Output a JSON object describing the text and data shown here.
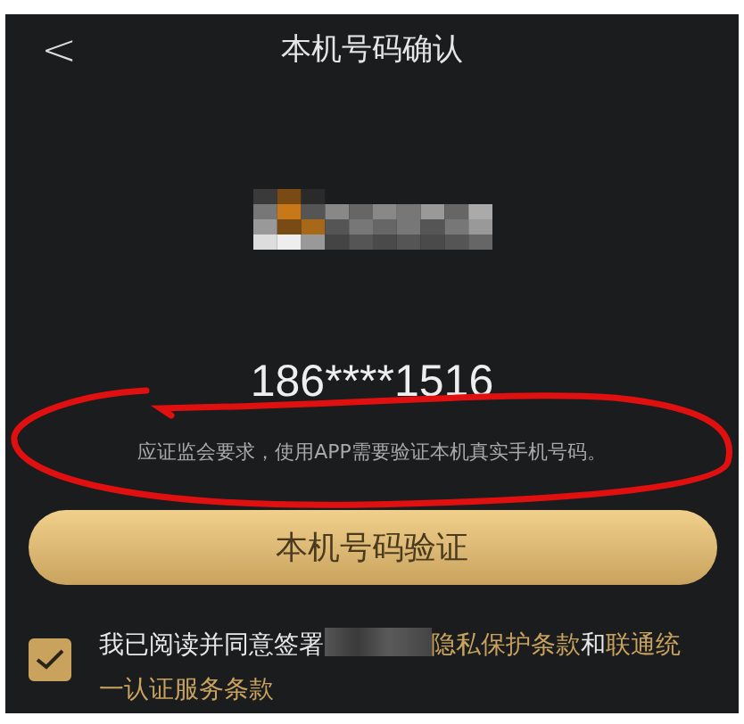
{
  "header": {
    "back": "<",
    "title": "本机号码确认"
  },
  "logo": {
    "kind": "redacted"
  },
  "phone_number": "186****1516",
  "notice": "应证监会要求，使用APP需要验证本机真实手机号码。",
  "verify_button": "本机号码验证",
  "agreement": {
    "checked": true,
    "segments": [
      {
        "kind": "text",
        "text": "我已阅读并同意签署"
      },
      {
        "kind": "redacted"
      },
      {
        "kind": "link",
        "text": "隐私保护条款"
      },
      {
        "kind": "text",
        "text": "和"
      },
      {
        "kind": "link",
        "text": "联通统一认证服务条款"
      }
    ]
  },
  "annotation": {
    "kind": "ellipse",
    "color": "#e01010"
  }
}
